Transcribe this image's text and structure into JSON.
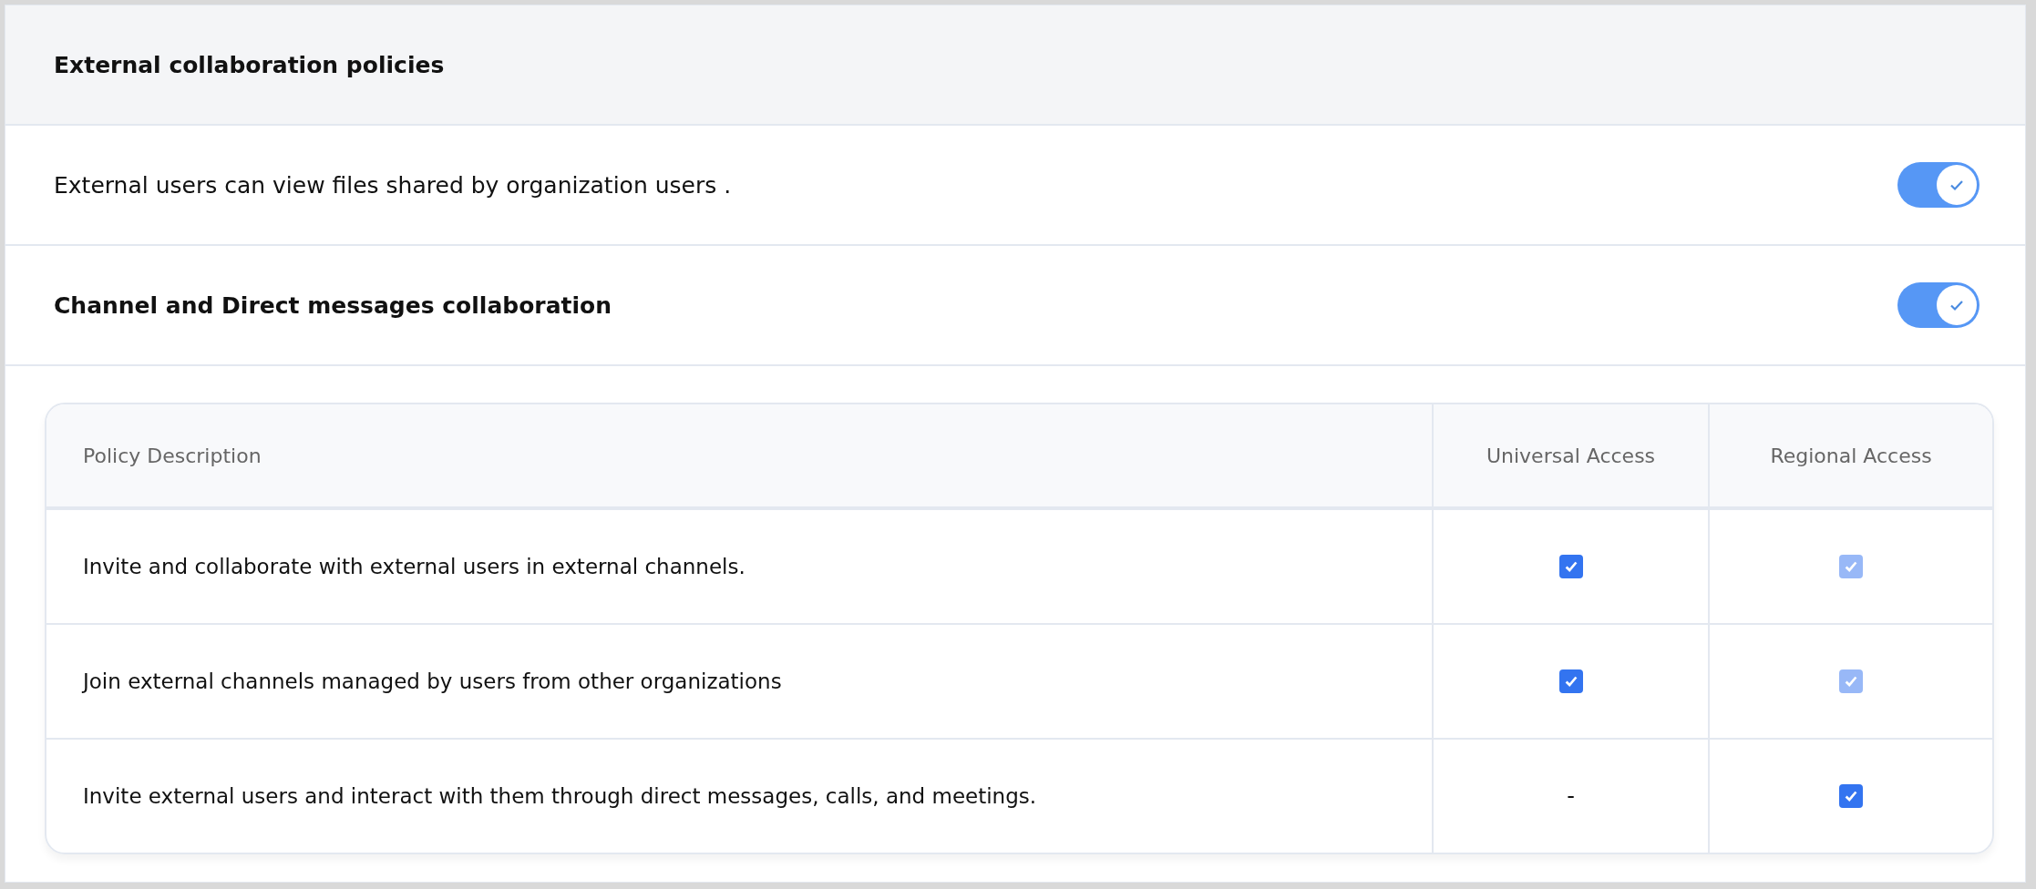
{
  "panel": {
    "title": "External collaboration policies"
  },
  "settings": [
    {
      "label": "External users can view files shared by organization users .",
      "bold": false,
      "on": true
    },
    {
      "label": "Channel and Direct messages collaboration",
      "bold": true,
      "on": true
    }
  ],
  "table": {
    "columns": [
      "Policy Description",
      "Universal Access",
      "Regional Access"
    ],
    "rows": [
      {
        "cells": [
          {
            "kind": "text",
            "text": "Invite and collaborate with external users in external channels."
          },
          {
            "kind": "checkbox",
            "checked": true,
            "disabled": false
          },
          {
            "kind": "checkbox",
            "checked": true,
            "disabled": true
          }
        ]
      },
      {
        "cells": [
          {
            "kind": "text",
            "text": "Join external channels managed by users from other organizations"
          },
          {
            "kind": "checkbox",
            "checked": true,
            "disabled": false
          },
          {
            "kind": "checkbox",
            "checked": true,
            "disabled": true
          }
        ]
      },
      {
        "cells": [
          {
            "kind": "text",
            "text": "Invite external users and interact with them through direct messages, calls, and meetings."
          },
          {
            "kind": "text",
            "text": "-"
          },
          {
            "kind": "checkbox",
            "checked": true,
            "disabled": false
          }
        ]
      }
    ]
  }
}
